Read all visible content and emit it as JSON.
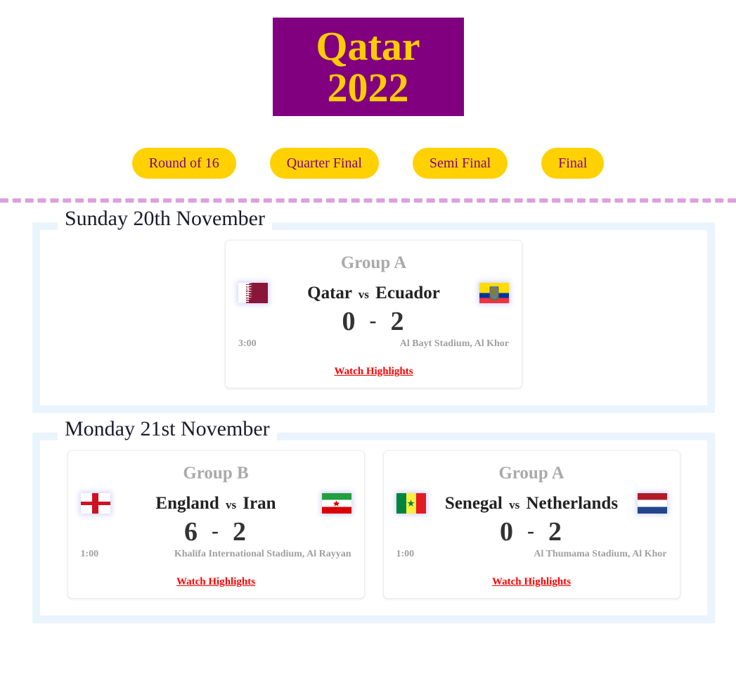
{
  "banner": {
    "line1": "Qatar",
    "line2": "2022",
    "bg_color": "#800080",
    "text_color": "#FFCC00"
  },
  "nav": {
    "items": [
      {
        "label": "Round of 16",
        "name": "nav-round-of-16"
      },
      {
        "label": "Quarter Final",
        "name": "nav-quarter-final"
      },
      {
        "label": "Semi Final",
        "name": "nav-semi-final"
      },
      {
        "label": "Final",
        "name": "nav-final"
      }
    ],
    "pill_bg": "#FFD100",
    "pill_text": "#800080"
  },
  "divider": {
    "color": "#DDA0DD",
    "style": "dashed"
  },
  "days": [
    {
      "date_label": "Sunday 20th November",
      "matches": [
        {
          "group": "Group A",
          "home_team": "Qatar",
          "away_team": "Ecuador",
          "vs": "vs",
          "home_score": "0",
          "away_score": "2",
          "separator": "-",
          "time": "3:00",
          "stadium": "Al Bayt Stadium, Al Khor",
          "highlights_label": "Watch Highlights",
          "home_flag": "flag-qatar",
          "away_flag": "flag-ecuador"
        }
      ]
    },
    {
      "date_label": "Monday 21st November",
      "matches": [
        {
          "group": "Group B",
          "home_team": "England",
          "away_team": "Iran",
          "vs": "vs",
          "home_score": "6",
          "away_score": "2",
          "separator": "-",
          "time": "1:00",
          "stadium": "Khalifa International Stadium, Al Rayyan",
          "highlights_label": "Watch Highlights",
          "home_flag": "flag-england",
          "away_flag": "flag-iran"
        },
        {
          "group": "Group A",
          "home_team": "Senegal",
          "away_team": "Netherlands",
          "vs": "vs",
          "home_score": "0",
          "away_score": "2",
          "separator": "-",
          "time": "1:00",
          "stadium": "Al Thumama Stadium, Al Khor",
          "highlights_label": "Watch Highlights",
          "home_flag": "flag-senegal",
          "away_flag": "flag-netherlands"
        }
      ]
    }
  ]
}
